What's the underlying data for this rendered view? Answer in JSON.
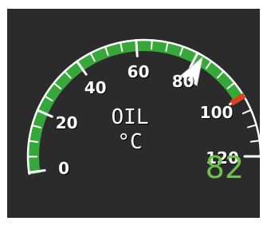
{
  "gauge": {
    "title": "OIL",
    "unit": "°C",
    "value": 82,
    "readout": "82",
    "min": 0,
    "max": 120,
    "green_range": [
      0,
      100
    ],
    "redline": 100,
    "tick_labels": [
      "0",
      "20",
      "40",
      "60",
      "80",
      "100",
      "120"
    ],
    "colors": {
      "panel": "#2b2b2b",
      "arc_green": "#36a83a",
      "redline": "#e0401a",
      "tick": "#ffffff",
      "needle": "#ffffff",
      "readout": "#6cc24a"
    },
    "pointer_icon": "triangle-pointer-icon"
  }
}
